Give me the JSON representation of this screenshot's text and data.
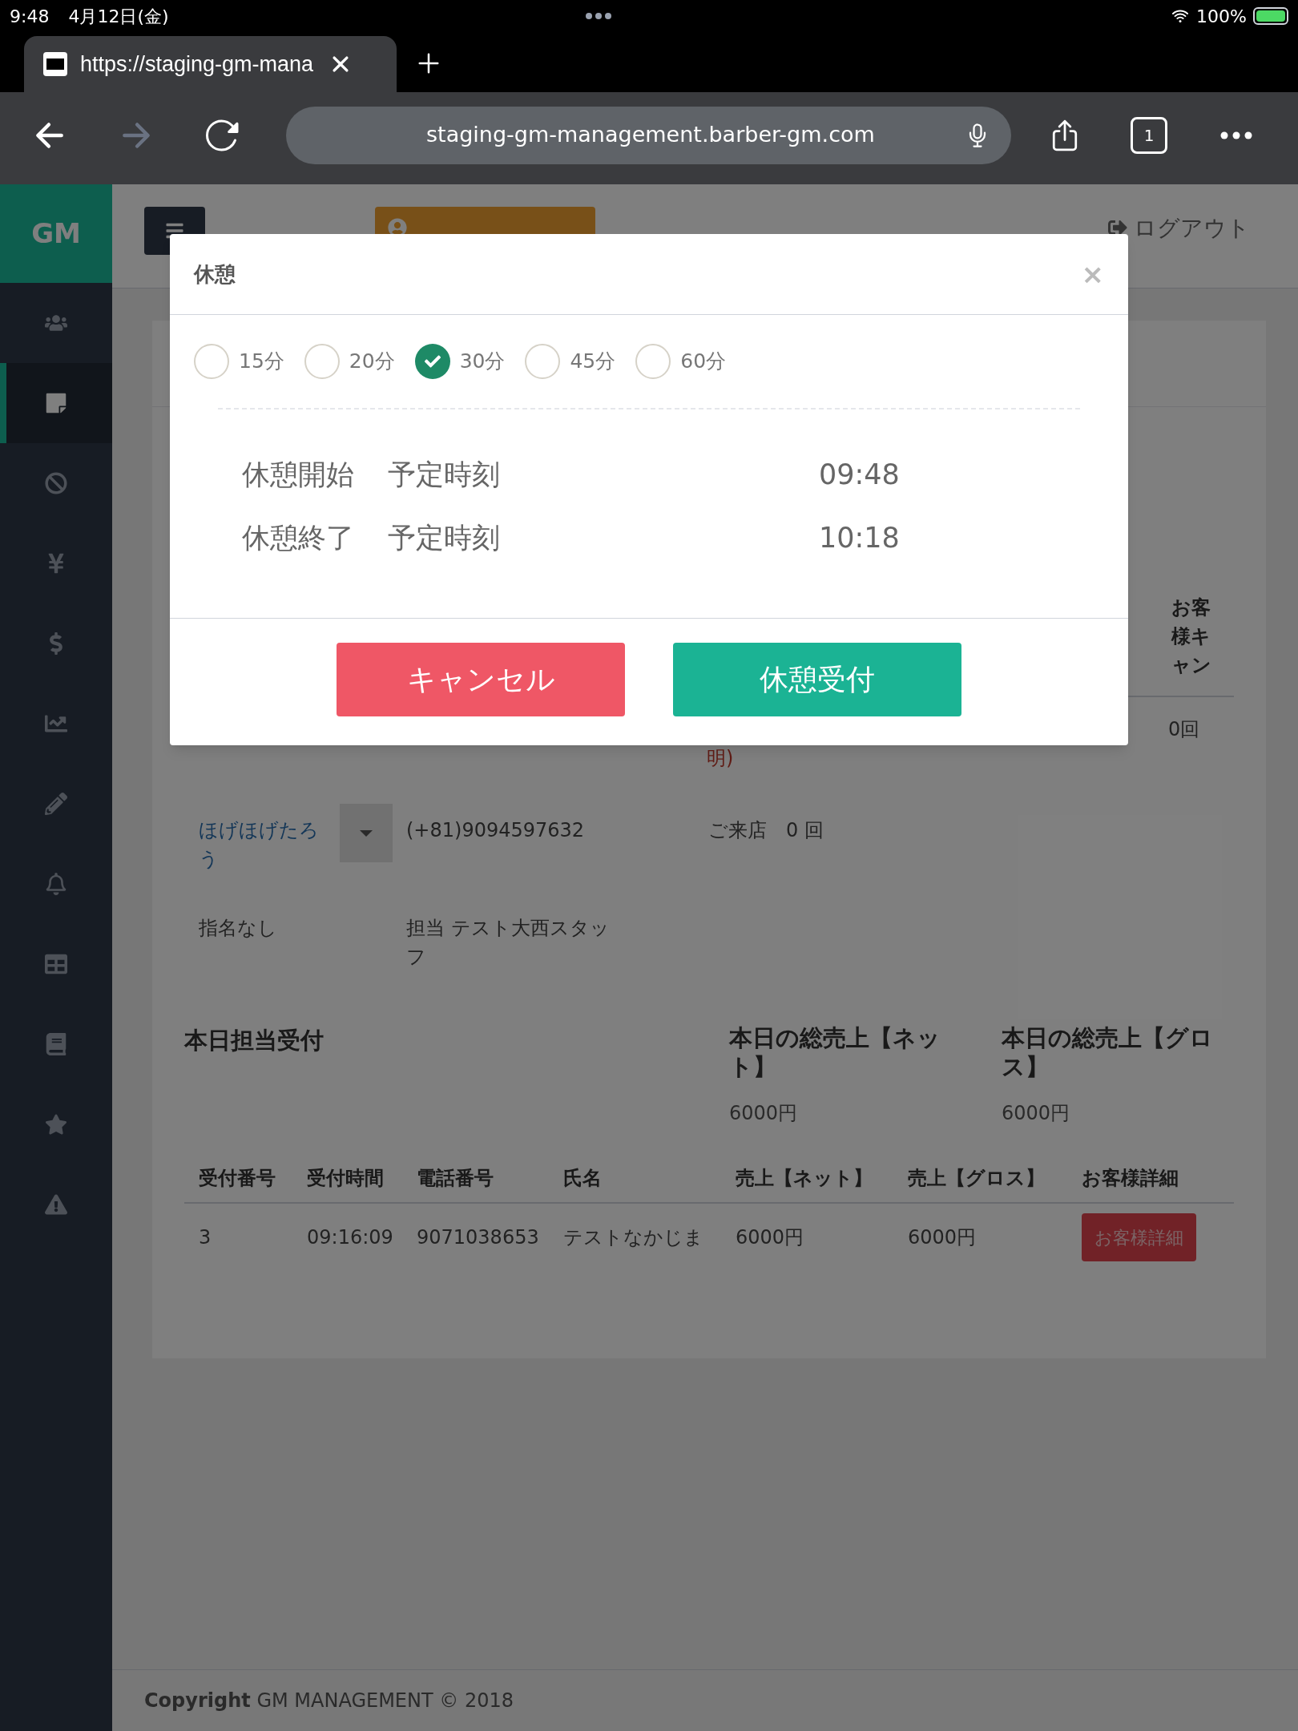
{
  "status_bar": {
    "time": "9:48",
    "date": "4月12日(金)",
    "battery": "100%"
  },
  "browser": {
    "tab_title": "https://staging-gm-mana",
    "url": "staging-gm-management.barber-gm.com",
    "tab_count": "1"
  },
  "sidebar": {
    "logo": "GM",
    "items": [
      {
        "kind": "users",
        "selected": false
      },
      {
        "kind": "note",
        "selected": true
      },
      {
        "kind": "ban",
        "selected": false
      },
      {
        "kind": "yen",
        "selected": false
      },
      {
        "kind": "dollar",
        "selected": false
      },
      {
        "kind": "chart",
        "selected": false
      },
      {
        "kind": "pencil",
        "selected": false
      },
      {
        "kind": "bell",
        "selected": false
      },
      {
        "kind": "table",
        "selected": false
      },
      {
        "kind": "book",
        "selected": false
      },
      {
        "kind": "star",
        "selected": false
      },
      {
        "kind": "warning",
        "selected": false
      }
    ]
  },
  "header": {
    "logout": "ログアウト"
  },
  "reservation": {
    "column_header": "お客様キャン",
    "row": [
      {
        "text": "明)",
        "kind": "alert"
      },
      {
        "text": "0回",
        "kind": "plain"
      }
    ],
    "customer_name": "ほげほげたろう",
    "phone": "(+81)9094597632",
    "visits": "ご来店　0 回",
    "nomination": "指名なし",
    "staff": "担当 テスト大西スタッフ"
  },
  "summary": {
    "title": "本日担当受付",
    "net_label": "本日の総売上【ネット】",
    "net_value": "6000円",
    "gross_label": "本日の総売上【グロス】",
    "gross_value": "6000円"
  },
  "table": {
    "columns": [
      "受付番号",
      "受付時間",
      "電話番号",
      "氏名",
      "売上【ネット】",
      "売上【グロス】",
      "お客様詳細"
    ],
    "rows": [
      {
        "cells": [
          "3",
          "09:16:09",
          "9071038653",
          "テストなかじま",
          "6000円",
          "6000円"
        ],
        "button": "お客様詳細"
      }
    ]
  },
  "footer": {
    "label": "Copyright",
    "text": "GM MANAGEMENT © 2018"
  },
  "modal": {
    "title": "休憩",
    "close": "×",
    "options": [
      {
        "label": "15分",
        "selected": false
      },
      {
        "label": "20分",
        "selected": false
      },
      {
        "label": "30分",
        "selected": true
      },
      {
        "label": "45分",
        "selected": false
      },
      {
        "label": "60分",
        "selected": false
      }
    ],
    "rows": [
      {
        "label": "休憩開始",
        "sub": "予定時刻",
        "time": "09:48"
      },
      {
        "label": "休憩終了",
        "sub": "予定時刻",
        "time": "10:18"
      }
    ],
    "cancel": "キャンセル",
    "confirm": "休憩受付"
  }
}
